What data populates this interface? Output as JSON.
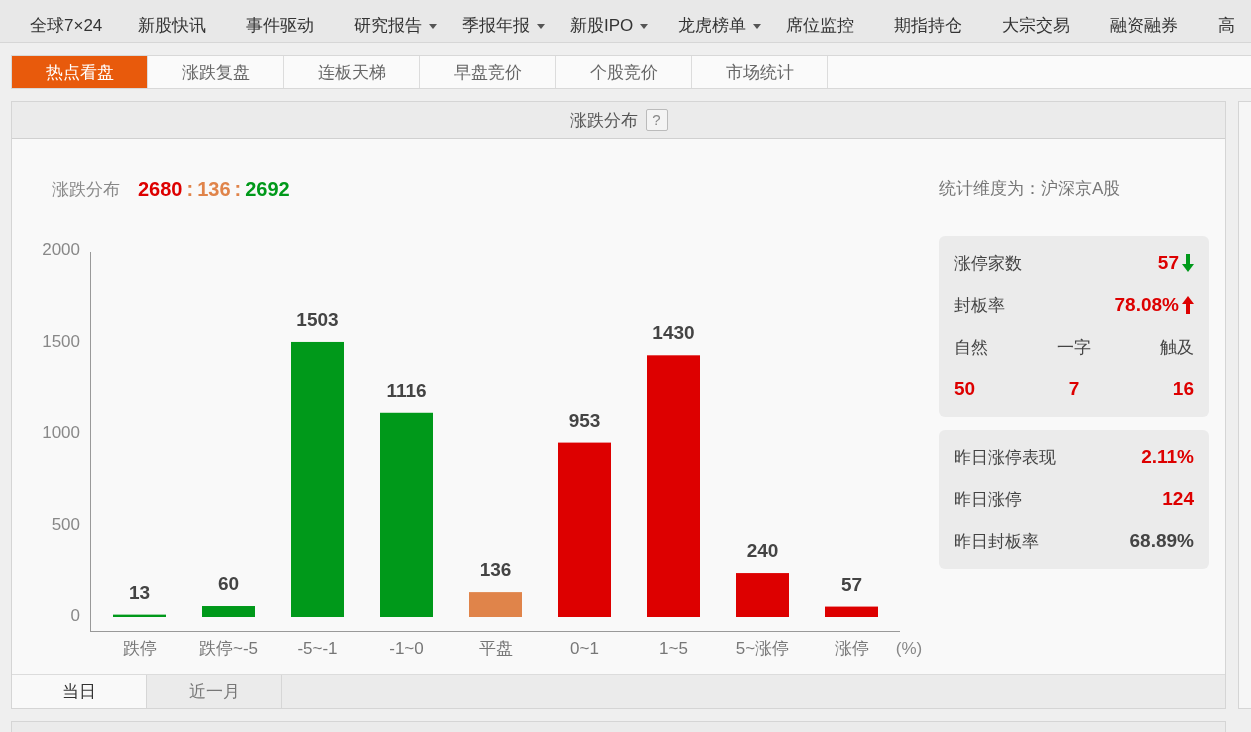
{
  "nav": {
    "items": [
      {
        "label": "全球7×24",
        "dropdown": false
      },
      {
        "label": "新股快讯",
        "dropdown": false
      },
      {
        "label": "事件驱动",
        "dropdown": false
      },
      {
        "label": "研究报告",
        "dropdown": true
      },
      {
        "label": "季报年报",
        "dropdown": true
      },
      {
        "label": "新股IPO",
        "dropdown": true
      },
      {
        "label": "龙虎榜单",
        "dropdown": true
      },
      {
        "label": "席位监控",
        "dropdown": false
      },
      {
        "label": "期指持仓",
        "dropdown": false
      },
      {
        "label": "大宗交易",
        "dropdown": false
      },
      {
        "label": "融资融券",
        "dropdown": false
      },
      {
        "label": "高",
        "dropdown": false
      }
    ]
  },
  "tabs": [
    {
      "label": "热点看盘",
      "selected": true
    },
    {
      "label": "涨跌复盘",
      "selected": false
    },
    {
      "label": "连板天梯",
      "selected": false
    },
    {
      "label": "早盘竞价",
      "selected": false
    },
    {
      "label": "个股竞价",
      "selected": false
    },
    {
      "label": "市场统计",
      "selected": false
    }
  ],
  "panel": {
    "title": "涨跌分布",
    "help": "?",
    "summary": {
      "label": "涨跌分布",
      "separator": ":",
      "counts": [
        {
          "value": "2680",
          "color": "#dd0000"
        },
        {
          "value": "136",
          "color": "#e0844a"
        },
        {
          "value": "2692",
          "color": "#00991a"
        }
      ]
    },
    "chart_data": {
      "type": "bar",
      "categories": [
        "跌停",
        "跌停~-5",
        "-5~-1",
        "-1~0",
        "平盘",
        "0~1",
        "1~5",
        "5~涨停",
        "涨停"
      ],
      "values": [
        13,
        60,
        1503,
        1116,
        136,
        953,
        1430,
        240,
        57
      ],
      "colors": [
        "#00991a",
        "#00991a",
        "#00991a",
        "#00991a",
        "#e0844a",
        "#dd0000",
        "#dd0000",
        "#dd0000",
        "#dd0000"
      ],
      "yticks": [
        0,
        500,
        1000,
        1500,
        2000
      ],
      "ylim": [
        0,
        2000
      ],
      "data_labels": true,
      "xlabel": "(%)"
    },
    "stats": {
      "scope": "统计维度为：沪深京A股",
      "cards": [
        {
          "rows": [
            {
              "kind": "pair",
              "label": "涨停家数",
              "value": "57",
              "color": "#dd0000",
              "rising": false
            },
            {
              "kind": "pair",
              "label": "封板率",
              "value": "78.08%",
              "color": "#dd0000",
              "rising": true
            },
            {
              "kind": "split",
              "items": [
                {
                  "label": "自然",
                  "value": "50",
                  "color": "#dd0000"
                },
                {
                  "label": "一字",
                  "value": "7",
                  "color": "#dd0000"
                },
                {
                  "label": "触及",
                  "value": "16",
                  "color": "#dd0000"
                }
              ]
            }
          ]
        },
        {
          "rows": [
            {
              "kind": "pair",
              "label": "昨日涨停表现",
              "value": "2.11%",
              "color": "#dd0000"
            },
            {
              "kind": "pair",
              "label": "昨日涨停",
              "value": "124",
              "color": "#dd0000"
            },
            {
              "kind": "pair",
              "label": "昨日封板率",
              "value": "68.89%",
              "color": "#444444"
            }
          ]
        }
      ]
    },
    "bottom_tabs": [
      {
        "label": "当日",
        "selected": true
      },
      {
        "label": "近一月",
        "selected": false
      }
    ]
  }
}
